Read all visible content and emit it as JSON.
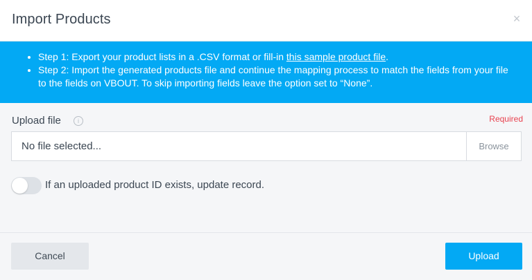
{
  "dialog": {
    "title": "Import Products",
    "close_glyph": "×"
  },
  "info": {
    "step1_text": "Step 1: Export your product lists in a .CSV format or fill-in ",
    "step1_link": "this sample product file",
    "step1_end": ".",
    "step2_text": "Step 2: Import the generated products file and continue the mapping process to match the fields from your file to the fields on VBOUT. To skip importing fields leave the option set to “None”."
  },
  "upload": {
    "label": "Upload file",
    "info_icon_glyph": "i",
    "required_text": "Required",
    "file_value": "No file selected...",
    "browse_label": "Browse"
  },
  "toggle": {
    "label": "If an uploaded product ID exists, update record.",
    "state": "off"
  },
  "footer": {
    "cancel_label": "Cancel",
    "upload_label": "Upload"
  },
  "colors": {
    "accent": "#03a9f4",
    "required": "#e8424f",
    "background": "#f5f6f8"
  },
  "icons": {
    "close": "close-icon",
    "info": "info-icon"
  }
}
